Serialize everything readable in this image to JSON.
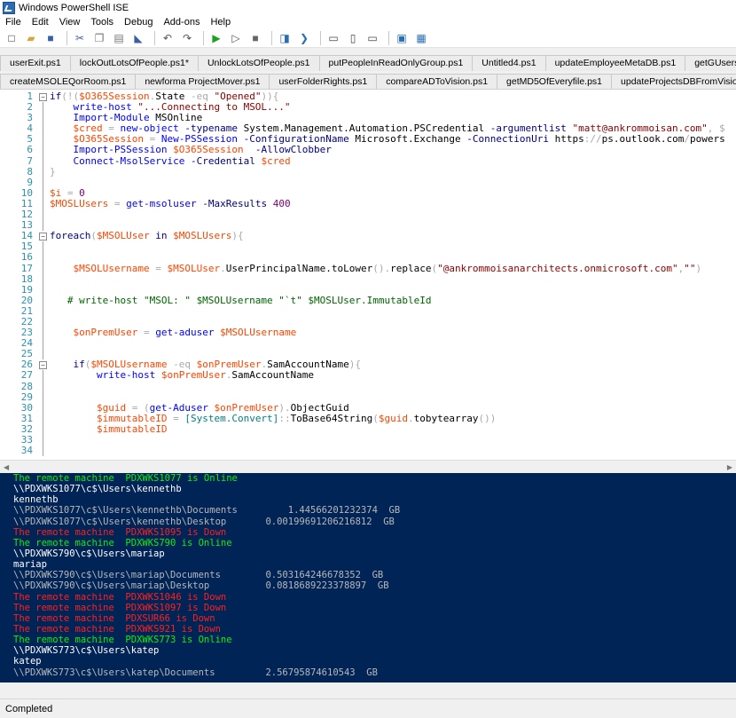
{
  "window": {
    "title": "Windows PowerShell ISE"
  },
  "menu": [
    "File",
    "Edit",
    "View",
    "Tools",
    "Debug",
    "Add-ons",
    "Help"
  ],
  "toolbar_icons": [
    "new-icon",
    "open-icon",
    "save-icon",
    "cut-icon",
    "copy-icon",
    "paste-icon",
    "clear-icon",
    "undo-icon",
    "redo-icon",
    "run-icon",
    "run-selection-icon",
    "stop-icon",
    "remote-icon",
    "powershell-icon",
    "layout-top-icon",
    "layout-right-icon",
    "layout-max-icon",
    "show-commands-icon",
    "show-addon-icon"
  ],
  "tabs_row1": [
    "userExit.ps1",
    "lockOutLotsOfPeople.ps1*",
    "UnlockLotsOfPeople.ps1",
    "putPeopleInReadOnlyGroup.ps1",
    "Untitled4.ps1",
    "updateEmployeeMetaDB.ps1",
    "getGUsersDirSizes.ps1",
    "get"
  ],
  "tabs_row2": [
    "createMSOLEQorRoom.ps1",
    "newforma ProjectMover.ps1",
    "userFolderRights.ps1",
    "compareADToVision.ps1",
    "getMD5OfEveryfile.ps1",
    "updateProjectsDBFromVision.ps1",
    "getX"
  ],
  "editor_lines": [
    {
      "n": "1",
      "fold": "-",
      "text": "if(!($O365Session.State -eq \"Opened\")){"
    },
    {
      "n": "2",
      "fold": "",
      "text": "    write-host \"...Connecting to MSOL...\""
    },
    {
      "n": "3",
      "fold": "",
      "text": "    Import-Module MSOnline"
    },
    {
      "n": "4",
      "fold": "",
      "text": "    $cred = new-object -typename System.Management.Automation.PSCredential -argumentlist \"matt@ankrommoisan.com\", $"
    },
    {
      "n": "5",
      "fold": "",
      "text": "    $O365Session = New-PSSession -ConfigurationName Microsoft.Exchange -ConnectionUri https://ps.outlook.com/powers"
    },
    {
      "n": "6",
      "fold": "",
      "text": "    Import-PSSession $O365Session  -AllowClobber"
    },
    {
      "n": "7",
      "fold": "",
      "text": "    Connect-MsolService -Credential $cred"
    },
    {
      "n": "8",
      "fold": "",
      "text": "}"
    },
    {
      "n": "9",
      "fold": "",
      "text": ""
    },
    {
      "n": "10",
      "fold": "",
      "text": "$i = 0"
    },
    {
      "n": "11",
      "fold": "",
      "text": "$MOSLUsers = get-msoluser -MaxResults 400"
    },
    {
      "n": "12",
      "fold": "",
      "text": ""
    },
    {
      "n": "13",
      "fold": "",
      "text": ""
    },
    {
      "n": "14",
      "fold": "-",
      "text": "foreach($MSOLUser in $MOSLUsers){"
    },
    {
      "n": "15",
      "fold": "",
      "text": ""
    },
    {
      "n": "16",
      "fold": "",
      "text": ""
    },
    {
      "n": "17",
      "fold": "",
      "text": "    $MSOLUsername = $MSOLUser.UserPrincipalName.toLower().replace(\"@ankrommoisanarchitects.onmicrosoft.com\",\"\")"
    },
    {
      "n": "18",
      "fold": "",
      "text": ""
    },
    {
      "n": "19",
      "fold": "",
      "text": ""
    },
    {
      "n": "20",
      "fold": "",
      "text": "   # write-host \"MSOL: \" $MSOLUsername \"`t\" $MOSLUser.ImmutableId"
    },
    {
      "n": "21",
      "fold": "",
      "text": ""
    },
    {
      "n": "22",
      "fold": "",
      "text": ""
    },
    {
      "n": "23",
      "fold": "",
      "text": "    $onPremUser = get-aduser $MSOLUsername"
    },
    {
      "n": "24",
      "fold": "",
      "text": ""
    },
    {
      "n": "25",
      "fold": "",
      "text": ""
    },
    {
      "n": "26",
      "fold": "-",
      "text": "    if($MSOLUsername -eq $onPremUser.SamAccountName){"
    },
    {
      "n": "27",
      "fold": "",
      "text": "        write-host $onPremUser.SamAccountName"
    },
    {
      "n": "28",
      "fold": "",
      "text": ""
    },
    {
      "n": "29",
      "fold": "",
      "text": ""
    },
    {
      "n": "30",
      "fold": "",
      "text": "        $guid = (get-Aduser $onPremUser).ObjectGuid"
    },
    {
      "n": "31",
      "fold": "",
      "text": "        $immutableID = [System.Convert]::ToBase64String($guid.tobytearray())"
    },
    {
      "n": "32",
      "fold": "",
      "text": "        $immutableID"
    },
    {
      "n": "33",
      "fold": "",
      "text": ""
    },
    {
      "n": "34",
      "fold": "",
      "text": ""
    }
  ],
  "console_lines": [
    {
      "c": "green",
      "text": "The remote machine  PDXWKS1077 is Online"
    },
    {
      "c": "white",
      "text": "\\\\PDXWKS1077\\c$\\Users\\kennethb"
    },
    {
      "c": "white",
      "text": "kennethb"
    },
    {
      "c": "gray",
      "text": "\\\\PDXWKS1077\\c$\\Users\\kennethb\\Documents         1.44566201232374  GB"
    },
    {
      "c": "gray",
      "text": "\\\\PDXWKS1077\\c$\\Users\\kennethb\\Desktop       0.00199691206216812  GB"
    },
    {
      "c": "red",
      "text": "The remote machine  PDXWKS1095 is Down"
    },
    {
      "c": "green",
      "text": "The remote machine  PDXWKS790 is Online"
    },
    {
      "c": "white",
      "text": "\\\\PDXWKS790\\c$\\Users\\mariap"
    },
    {
      "c": "white",
      "text": "mariap"
    },
    {
      "c": "gray",
      "text": "\\\\PDXWKS790\\c$\\Users\\mariap\\Documents        0.503164246678352  GB"
    },
    {
      "c": "gray",
      "text": "\\\\PDXWKS790\\c$\\Users\\mariap\\Desktop          0.0818689223378897  GB"
    },
    {
      "c": "red",
      "text": "The remote machine  PDXWKS1046 is Down"
    },
    {
      "c": "red",
      "text": "The remote machine  PDXWKS1097 is Down"
    },
    {
      "c": "red",
      "text": "The remote machine  PDXSUR66 is Down"
    },
    {
      "c": "red",
      "text": "The remote machine  PDXWKS921 is Down"
    },
    {
      "c": "green",
      "text": "The remote machine  PDXWKS773 is Online"
    },
    {
      "c": "white",
      "text": "\\\\PDXWKS773\\c$\\Users\\katep"
    },
    {
      "c": "white",
      "text": "katep"
    },
    {
      "c": "gray",
      "text": "\\\\PDXWKS773\\c$\\Users\\katep\\Documents         2.56795874610543  GB"
    }
  ],
  "status": {
    "text": "Completed"
  },
  "colors": {
    "console_bg": "#012456",
    "line_number": "#2b91af",
    "keyword": "#00008b",
    "variable": "#ff4500",
    "command": "#0000ff",
    "string": "#8b0000",
    "type": "#008080",
    "operator": "#a9a9a9",
    "comment": "#006400",
    "param": "#000080",
    "member": "#000000",
    "number": "#800080"
  }
}
